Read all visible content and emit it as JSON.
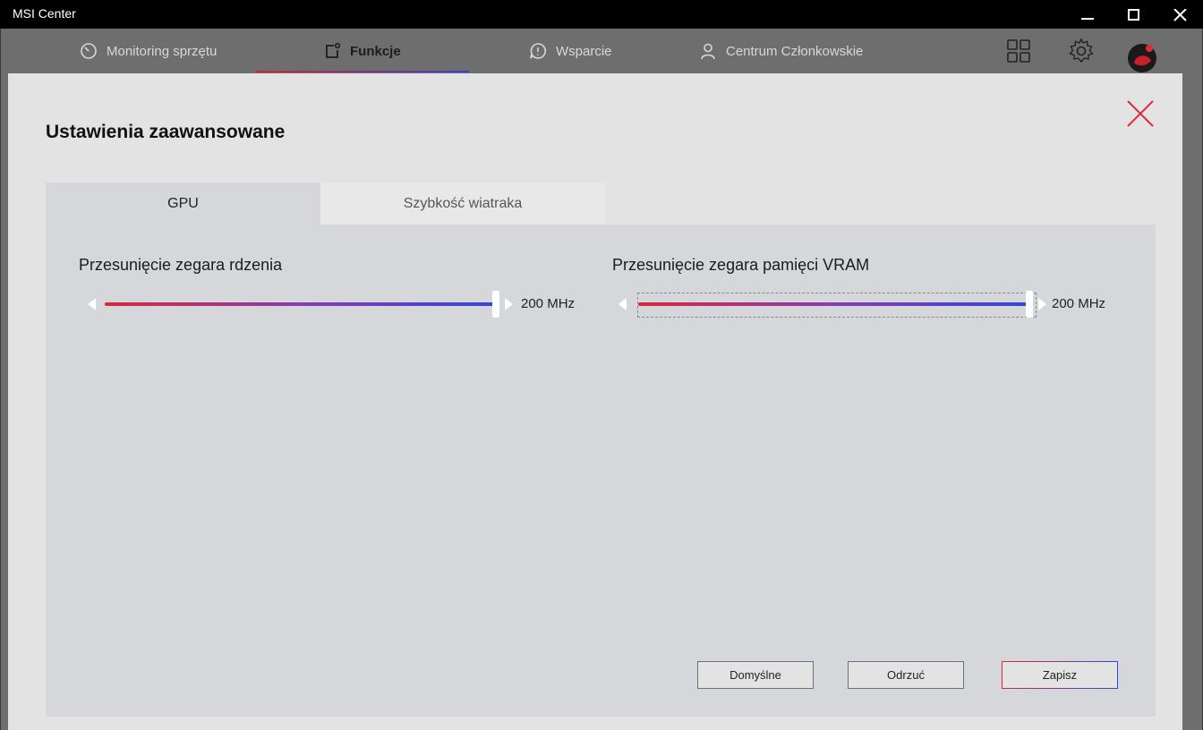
{
  "window": {
    "title": "MSI Center",
    "controls": {
      "minimize": "minimize-icon",
      "maximize": "maximize-icon",
      "close": "close-icon"
    }
  },
  "nav": {
    "items": [
      {
        "label": "Monitoring sprzętu",
        "icon": "monitoring-icon",
        "active": false
      },
      {
        "label": "Funkcje",
        "icon": "features-icon",
        "active": true
      },
      {
        "label": "Wsparcie",
        "icon": "support-icon",
        "active": false
      },
      {
        "label": "Centrum Członkowskie",
        "icon": "member-icon",
        "active": false
      }
    ],
    "right_icons": [
      "grid-icon",
      "gear-icon",
      "avatar"
    ]
  },
  "dialog": {
    "title": "Ustawienia zaawansowane",
    "tabs": [
      {
        "label": "GPU",
        "selected": true
      },
      {
        "label": "Szybkość wiatraka",
        "selected": false
      }
    ],
    "sliders": [
      {
        "label": "Przesunięcie zegara rdzenia",
        "value_text": "200 MHz",
        "level": 1.0
      },
      {
        "label": "Przesunięcie zegara pamięci VRAM",
        "value_text": "200 MHz",
        "level": 1.0
      }
    ],
    "buttons": {
      "default": "Domyślne",
      "discard": "Odrzuć",
      "save": "Zapisz"
    }
  },
  "colors": {
    "accent_red": "#d8273a",
    "accent_blue": "#3446d8",
    "titlebar": "#000000",
    "dialog_bg": "#e3e3e3",
    "panel_bg": "#d6d7da"
  }
}
